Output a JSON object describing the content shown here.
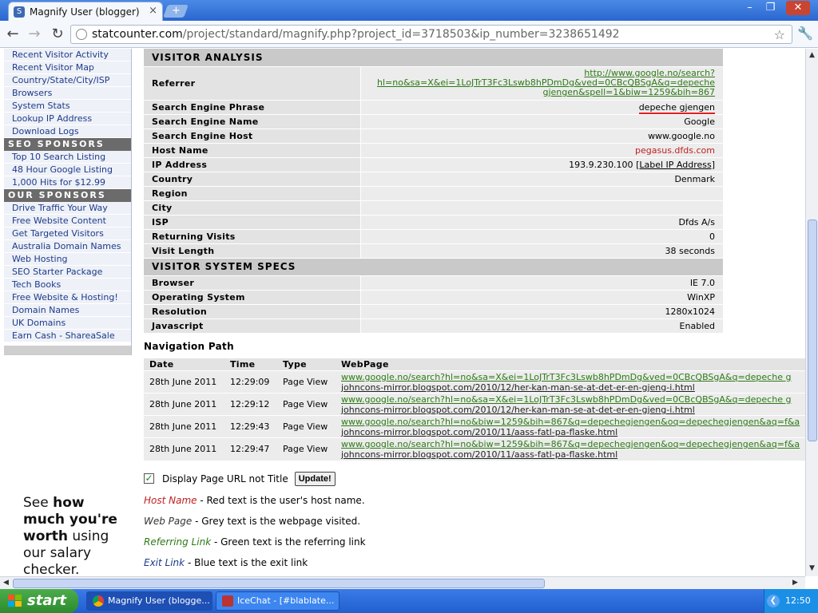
{
  "window": {
    "tab_title": "Magnify User (blogger)",
    "minimize": "–",
    "maximize": "❐",
    "close": "✕"
  },
  "toolbar": {
    "url_domain": "statcounter.com",
    "url_path": "/project/standard/magnify.php?project_id=3718503&ip_number=3238651492"
  },
  "sidebar": {
    "links_top": [
      "Recent Visitor Activity",
      "Recent Visitor Map",
      "Country/State/City/ISP",
      "Browsers",
      "System Stats",
      "Lookup IP Address",
      "Download Logs"
    ],
    "seo_heading": "SEO SPONSORS",
    "seo_links": [
      "Top 10 Search Listing",
      "48 Hour Google Listing",
      "1,000 Hits for $12.99"
    ],
    "our_heading": "OUR SPONSORS",
    "our_links": [
      "Drive Traffic Your Way",
      "Free Website Content",
      "Get Targeted Visitors",
      "Australia Domain Names",
      "Web Hosting",
      "SEO Starter Package",
      "Tech Books",
      "Free Website & Hosting!",
      "Domain Names",
      "UK Domains",
      "Earn Cash - ShareaSale"
    ],
    "ad": {
      "l1a": "See ",
      "l1b": "how",
      "l2": "much you're",
      "l3a": "worth",
      "l3b": " using",
      "l4": "our salary",
      "l5": "checker."
    }
  },
  "analysis": {
    "heading": "VISITOR ANALYSIS",
    "referrer_label": "Referrer",
    "referrer_lines": [
      "http://www.google.no/search?",
      "hl=no&sa=X&ei=1LoJTrT3Fc3Lswb8hPDmDg&ved=0CBcQBSgA&q=depeche",
      "gjengen&spell=1&biw=1259&bih=867"
    ],
    "rows": [
      {
        "k": "Search Engine Phrase",
        "v": "depeche gjengen"
      },
      {
        "k": "Search Engine Name",
        "v": "Google"
      },
      {
        "k": "Search Engine Host",
        "v": "www.google.no"
      },
      {
        "k": "Host Name",
        "v": "pegasus.dfds.com"
      },
      {
        "k": "IP Address",
        "v": "193.9.230.100 ",
        "v2": "[Label IP Address]"
      },
      {
        "k": "Country",
        "v": "Denmark"
      },
      {
        "k": "Region",
        "v": ""
      },
      {
        "k": "City",
        "v": ""
      },
      {
        "k": "ISP",
        "v": "Dfds A/s"
      },
      {
        "k": "Returning Visits",
        "v": "0"
      },
      {
        "k": "Visit Length",
        "v": "38 seconds"
      }
    ]
  },
  "specs": {
    "heading": "VISITOR SYSTEM SPECS",
    "rows": [
      {
        "k": "Browser",
        "v": "IE 7.0"
      },
      {
        "k": "Operating System",
        "v": "WinXP"
      },
      {
        "k": "Resolution",
        "v": "1280x1024"
      },
      {
        "k": "Javascript",
        "v": "Enabled"
      }
    ]
  },
  "navigation": {
    "title": "Navigation Path",
    "headers": [
      "Date",
      "Time",
      "Type",
      "WebPage"
    ],
    "rows": [
      {
        "date": "28th June 2011",
        "time": "12:29:09",
        "type": "Page View",
        "ref": "www.google.no/search?hl=no&sa=X&ei=1LoJTrT3Fc3Lswb8hPDmDg&ved=0CBcQBSgA&q=depeche g",
        "page": "johncons-mirror.blogspot.com/2010/12/her-kan-man-se-at-det-er-en-gjeng-i.html"
      },
      {
        "date": "28th June 2011",
        "time": "12:29:12",
        "type": "Page View",
        "ref": "www.google.no/search?hl=no&sa=X&ei=1LoJTrT3Fc3Lswb8hPDmDg&ved=0CBcQBSgA&q=depeche g",
        "page": "johncons-mirror.blogspot.com/2010/12/her-kan-man-se-at-det-er-en-gjeng-i.html"
      },
      {
        "date": "28th June 2011",
        "time": "12:29:43",
        "type": "Page View",
        "ref": "www.google.no/search?hl=no&biw=1259&bih=867&q=depechegjengen&oq=depechegjengen&aq=f&a",
        "page": "johncons-mirror.blogspot.com/2010/11/aass-fatl-pa-flaske.html"
      },
      {
        "date": "28th June 2011",
        "time": "12:29:47",
        "type": "Page View",
        "ref": "www.google.no/search?hl=no&biw=1259&bih=867&q=depechegjengen&oq=depechegjengen&aq=f&a",
        "page": "johncons-mirror.blogspot.com/2010/11/aass-fatl-pa-flaske.html"
      }
    ]
  },
  "options": {
    "checkbox_label": "Display Page URL not Title",
    "checked": true,
    "update_button": "Update!"
  },
  "legend": [
    {
      "term": "Host Name",
      "desc": " - Red text is the user's host name.",
      "color": "#c02020"
    },
    {
      "term": "Web Page",
      "desc": " - Grey text is the webpage visited.",
      "color": "#333333"
    },
    {
      "term": "Referring Link",
      "desc": " - Green text is the referring link",
      "color": "#2d7a16"
    },
    {
      "term": "Exit Link",
      "desc": " - Blue text is the exit link",
      "color": "#1d3a8a"
    }
  ],
  "taskbar": {
    "start": "start",
    "tasks": [
      "Magnify User (blogge...",
      "IceChat - [#blablate..."
    ],
    "clock": "12:50"
  },
  "colors": {
    "accent": "#2a66cf",
    "link_green": "#2d7a16",
    "host_red": "#c02020"
  }
}
